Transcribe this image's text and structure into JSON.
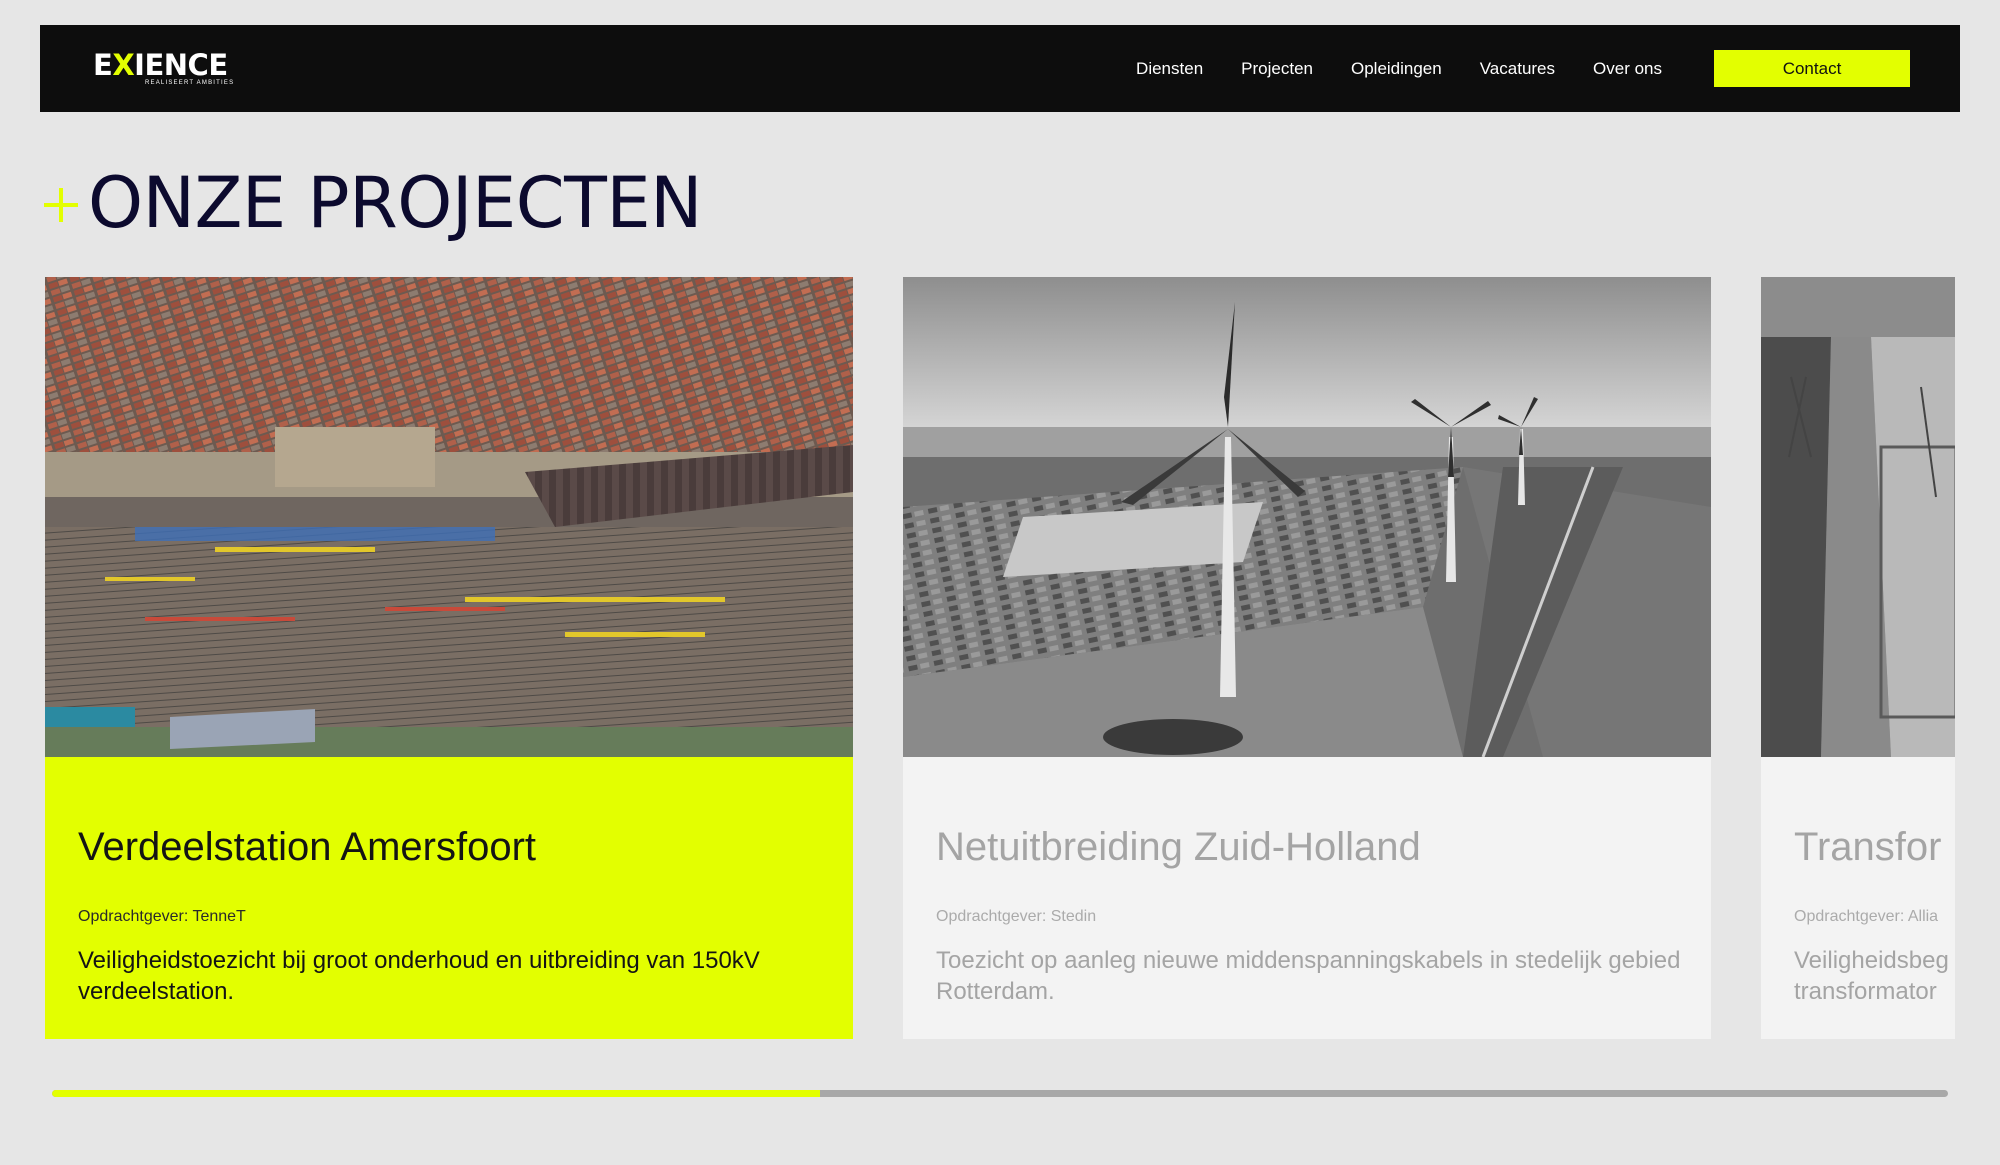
{
  "header": {
    "logo": {
      "wordmark_a": "E",
      "wordmark_x": "X",
      "wordmark_b": "IENCE",
      "tagline": "REALISEERT AMBITIES"
    },
    "nav": [
      "Diensten",
      "Projecten",
      "Opleidingen",
      "Vacatures",
      "Over ons"
    ],
    "contact_label": "Contact"
  },
  "page_title": "ONZE PROJECTEN",
  "projects": [
    {
      "title": "Verdeelstation Amersfoort",
      "client": "Opdrachtgever: TenneT",
      "description": "Veiligheidstoezicht bij groot onderhoud en uitbreiding van 150kV verdeelstation.",
      "state": "active",
      "image": "aerial-rail-yard-photo"
    },
    {
      "title": "Netuitbreiding Zuid-Holland",
      "client": "Opdrachtgever: Stedin",
      "description": "Toezicht op aanleg nieuwe middenspanningskabels in stedelijk gebied Rotterdam.",
      "state": "inactive",
      "image": "wind-turbines-photo"
    },
    {
      "title": "Transfor",
      "client": "Opdrachtgever: Allia",
      "description_line1": "Veiligheidsbeg",
      "description_line2": "transformator",
      "state": "inactive",
      "image": "substation-aerial-photo"
    }
  ],
  "slider": {
    "progress": 0.405
  },
  "colors": {
    "accent": "#e3ff00",
    "header_bg": "#0d0d0d",
    "title": "#0c0a2e",
    "page_bg": "#e6e6e6",
    "inactive_card": "#f3f3f3"
  }
}
